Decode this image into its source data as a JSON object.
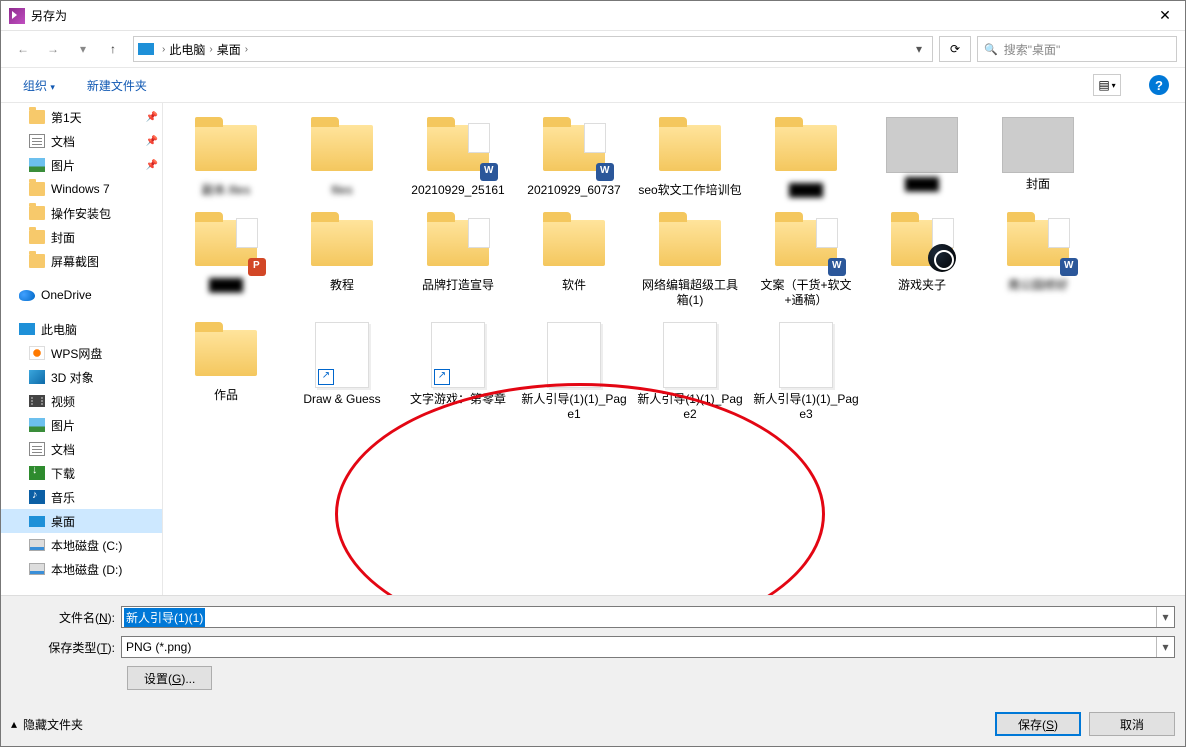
{
  "window": {
    "title": "另存为"
  },
  "breadcrumb": {
    "items": [
      "此电脑",
      "桌面"
    ]
  },
  "search": {
    "placeholder": "搜索\"桌面\""
  },
  "toolbar": {
    "organize": "组织",
    "new_folder": "新建文件夹"
  },
  "sidebar": [
    {
      "label": "第1天",
      "icon": "folder",
      "level": 1,
      "pinned": true
    },
    {
      "label": "文档",
      "icon": "doc",
      "level": 1,
      "pinned": true
    },
    {
      "label": "图片",
      "icon": "img",
      "level": 1,
      "pinned": true
    },
    {
      "label": "Windows 7",
      "icon": "folder",
      "level": 1
    },
    {
      "label": "操作安装包",
      "icon": "folder",
      "level": 1
    },
    {
      "label": "封面",
      "icon": "folder",
      "level": 1
    },
    {
      "label": "屏幕截图",
      "icon": "folder",
      "level": 1
    },
    {
      "label": "OneDrive",
      "icon": "onedrive",
      "level": 0,
      "gapbefore": true
    },
    {
      "label": "此电脑",
      "icon": "pc",
      "level": 0,
      "gapbefore": true
    },
    {
      "label": "WPS网盘",
      "icon": "wps",
      "level": 1
    },
    {
      "label": "3D 对象",
      "icon": "3d",
      "level": 1
    },
    {
      "label": "视频",
      "icon": "video",
      "level": 1
    },
    {
      "label": "图片",
      "icon": "img",
      "level": 1
    },
    {
      "label": "文档",
      "icon": "doc",
      "level": 1
    },
    {
      "label": "下载",
      "icon": "dl",
      "level": 1
    },
    {
      "label": "音乐",
      "icon": "music",
      "level": 1
    },
    {
      "label": "桌面",
      "icon": "desktop",
      "level": 1,
      "selected": true
    },
    {
      "label": "本地磁盘 (C:)",
      "icon": "disk",
      "level": 1
    },
    {
      "label": "本地磁盘 (D:)",
      "icon": "disk",
      "level": 1
    }
  ],
  "files": [
    {
      "label": "副本.files",
      "type": "folder",
      "blur": true
    },
    {
      "label": "files",
      "type": "folder",
      "blur": true
    },
    {
      "label": "20210929_25161",
      "type": "folder",
      "badge": "doc"
    },
    {
      "label": "20210929_60737",
      "type": "folder",
      "badge": "doc"
    },
    {
      "label": "seo软文工作培训包",
      "type": "folder"
    },
    {
      "label": "",
      "type": "folder",
      "blur": true
    },
    {
      "label": "",
      "type": "img",
      "blur": true
    },
    {
      "label": "封面",
      "type": "img"
    },
    {
      "label": "",
      "type": "folder",
      "badge": "ppt",
      "blur": true
    },
    {
      "label": "教程",
      "type": "folder"
    },
    {
      "label": "品牌打造宣导",
      "type": "folder",
      "thumbimg": true
    },
    {
      "label": "软件",
      "type": "folder"
    },
    {
      "label": "网络编辑超级工具箱(1)",
      "type": "folder"
    },
    {
      "label": "文案（干货+软文+通稿）",
      "type": "folder",
      "badge": "doc"
    },
    {
      "label": "游戏夹子",
      "type": "folder",
      "badge": "steam"
    },
    {
      "label": "南公园修好",
      "type": "folder",
      "badge": "doc",
      "blur": true
    },
    {
      "label": "作品",
      "type": "folder"
    },
    {
      "label": "Draw & Guess",
      "type": "shortcut"
    },
    {
      "label": "文字游戏：第零章",
      "type": "shortcut"
    },
    {
      "label": "新人引导(1)(1)_Page1",
      "type": "doc"
    },
    {
      "label": "新人引导(1)(1)_Page2",
      "type": "doc"
    },
    {
      "label": "新人引导(1)(1)_Page3",
      "type": "doc"
    }
  ],
  "filename": {
    "label": "文件名(N):",
    "value": "新人引导(1)(1)"
  },
  "filetype": {
    "label": "保存类型(T):",
    "value": "PNG (*.png)"
  },
  "settings": {
    "label": "设置(G)..."
  },
  "footer": {
    "hide_folders": "隐藏文件夹",
    "save": "保存(S)",
    "cancel": "取消"
  }
}
